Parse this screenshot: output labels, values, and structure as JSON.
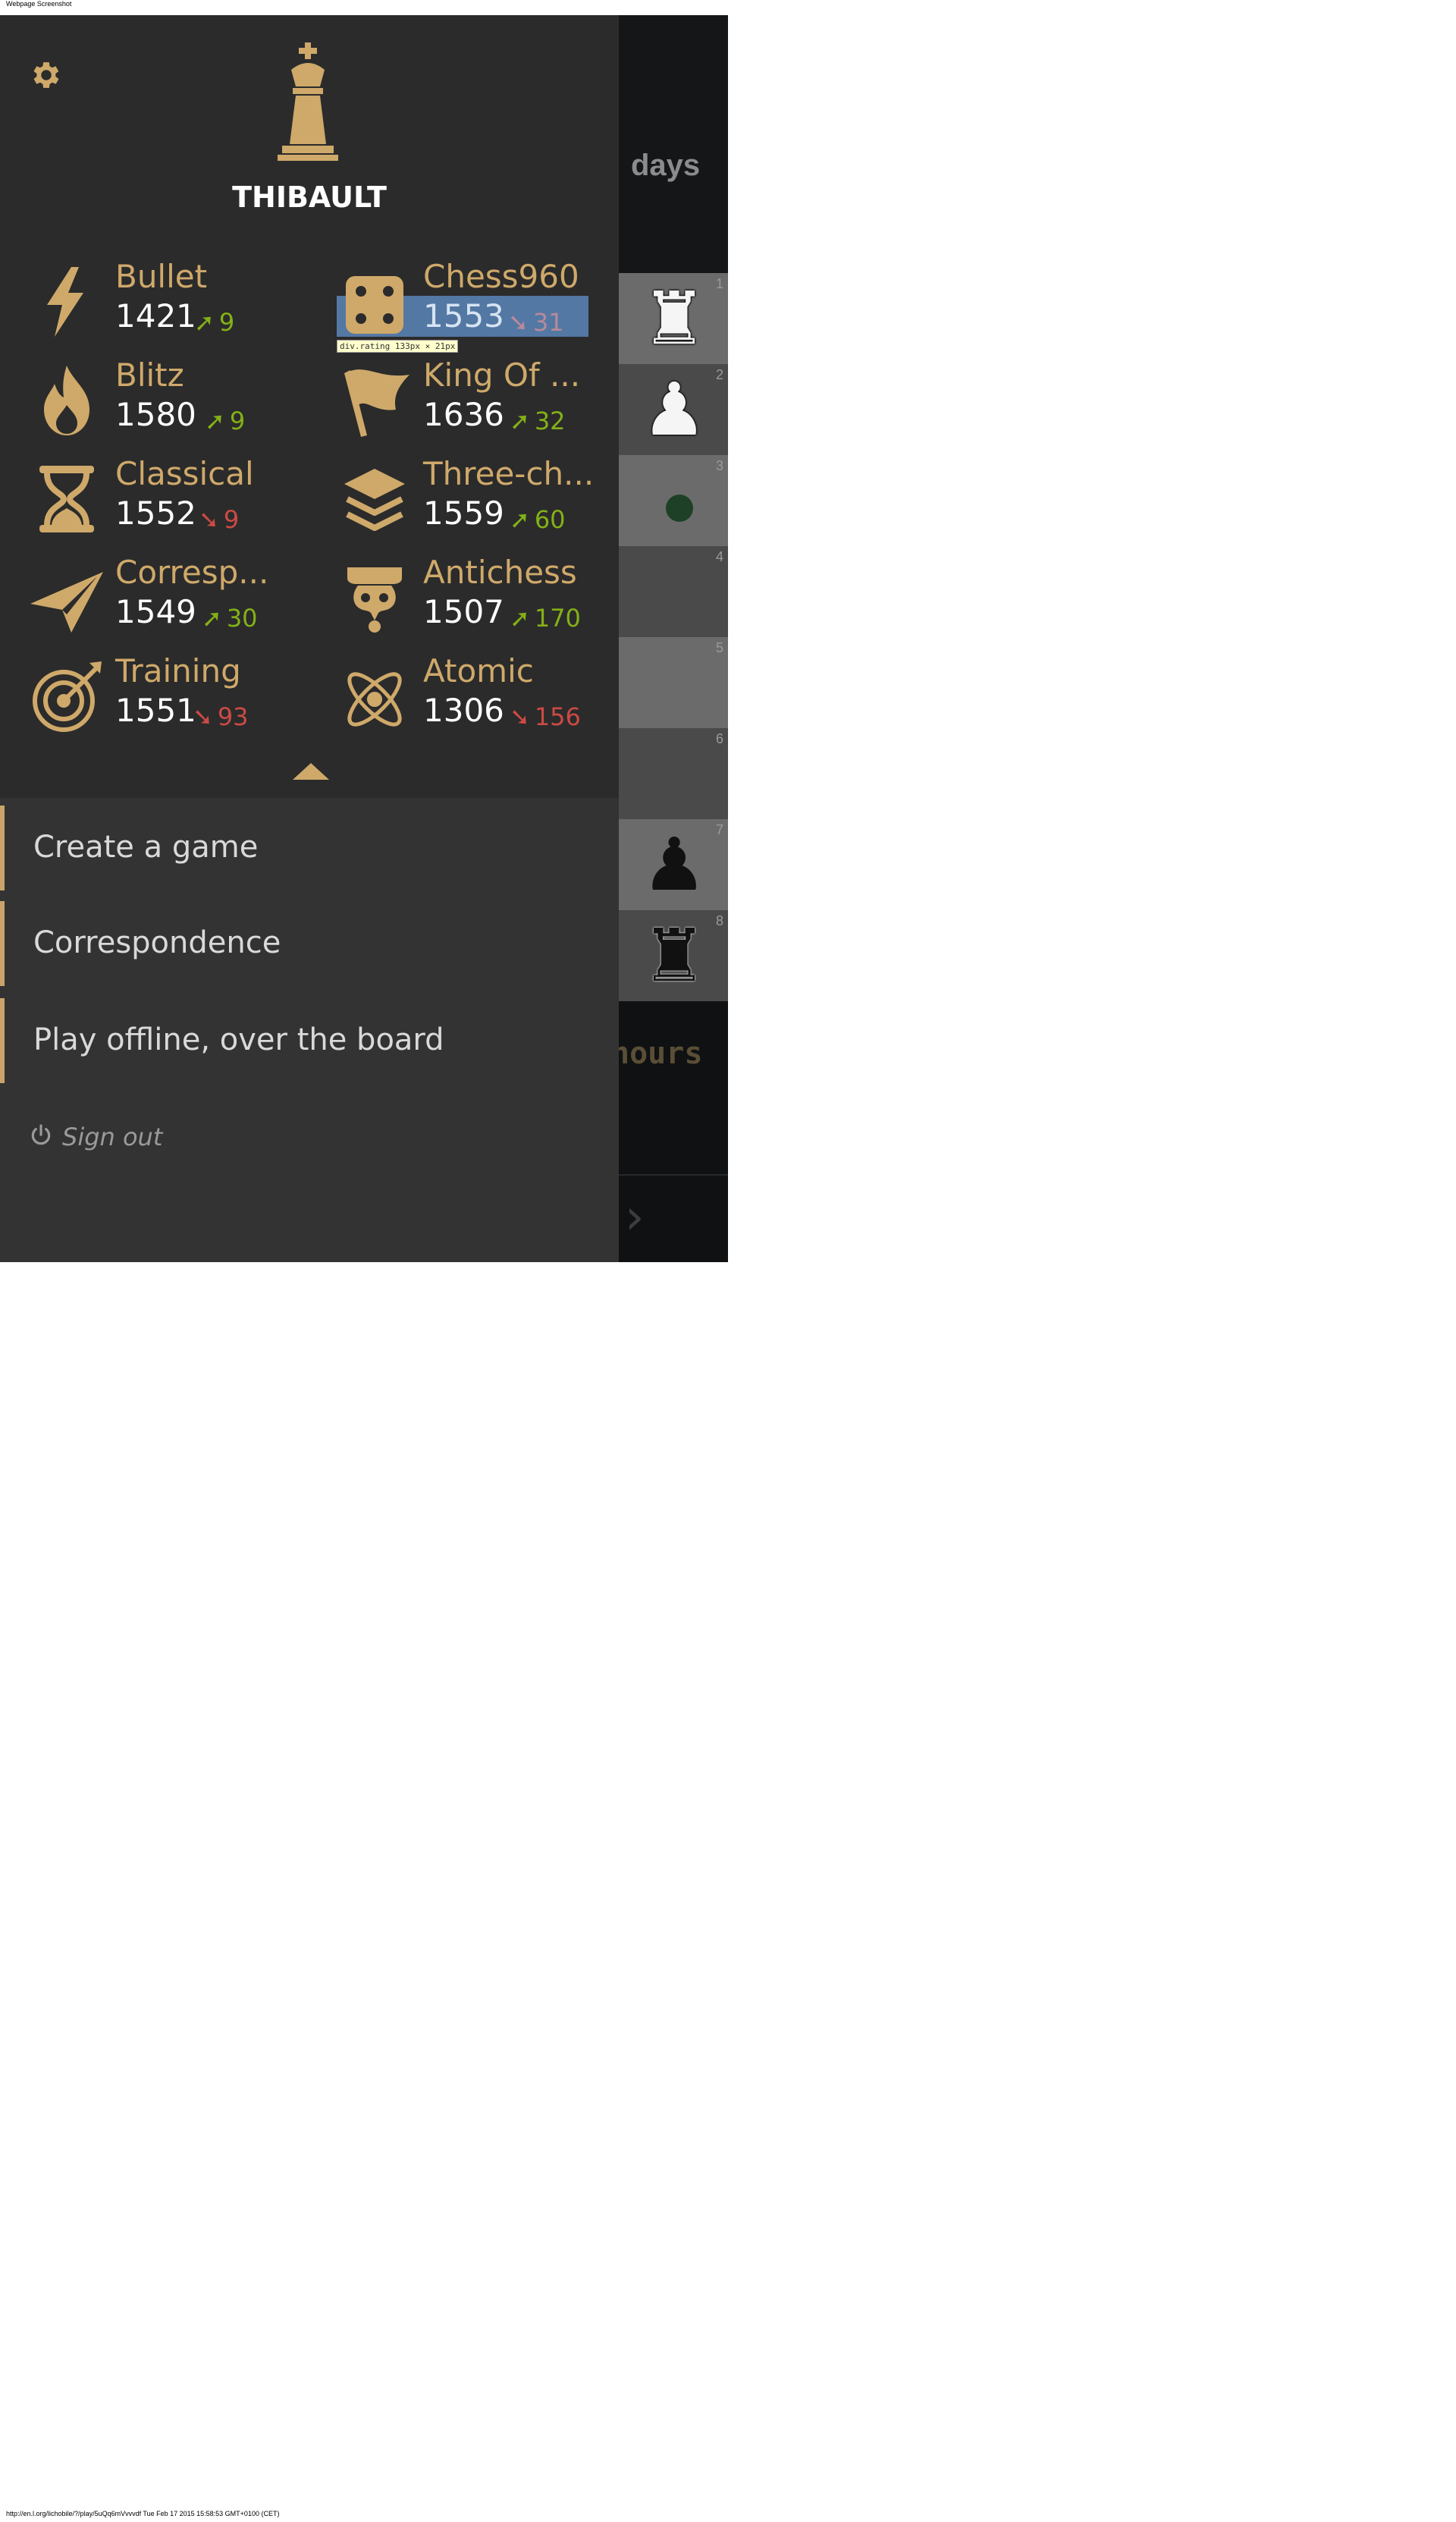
{
  "page": {
    "header_text": "Webpage Screenshot",
    "footer_text": "http://en.l.org/lichobile/?/play/5uQq6mVvvvdf Tue Feb 17 2015 15:58:53 GMT+0100 (CET)"
  },
  "background_app": {
    "timer_top": "days",
    "timer_bottom": "hours",
    "board_ranks": [
      "1",
      "2",
      "3",
      "4",
      "5",
      "6",
      "7",
      "8"
    ]
  },
  "drawer": {
    "username": "THIBAULT",
    "ratings": [
      {
        "name": "Bullet",
        "rating": "1421",
        "progress": "9",
        "direction": "up",
        "icon": "lightning-icon"
      },
      {
        "name": "Chess960",
        "rating": "1553",
        "progress": "31",
        "direction": "down",
        "icon": "dice-icon"
      },
      {
        "name": "Blitz",
        "rating": "1580",
        "progress": "9",
        "direction": "up",
        "icon": "fire-icon"
      },
      {
        "name": "King Of ...",
        "rating": "1636",
        "progress": "32",
        "direction": "up",
        "icon": "flag-icon"
      },
      {
        "name": "Classical",
        "rating": "1552",
        "progress": "9",
        "direction": "down",
        "icon": "hourglass-icon"
      },
      {
        "name": "Three-ch...",
        "rating": "1559",
        "progress": "60",
        "direction": "up",
        "icon": "layers-icon"
      },
      {
        "name": "Corresp...",
        "rating": "1549",
        "progress": "30",
        "direction": "up",
        "icon": "paper-plane-icon"
      },
      {
        "name": "Antichess",
        "rating": "1507",
        "progress": "170",
        "direction": "up",
        "icon": "antichess-icon"
      },
      {
        "name": "Training",
        "rating": "1551",
        "progress": "93",
        "direction": "down",
        "icon": "target-icon"
      },
      {
        "name": "Atomic",
        "rating": "1306",
        "progress": "156",
        "direction": "down",
        "icon": "atom-icon"
      }
    ],
    "inspect_tooltip": "div.rating 133px × 21px",
    "menu": [
      {
        "label": "Create a game"
      },
      {
        "label": "Correspondence"
      },
      {
        "label": "Play offline, over the board"
      }
    ],
    "signout_label": "Sign out"
  },
  "colors": {
    "drawer_bg": "#2b2b2b",
    "menu_bg": "#333333",
    "accent_gold": "#cfa96a",
    "rating_up": "#83b017",
    "rating_down": "#cc4a45"
  }
}
